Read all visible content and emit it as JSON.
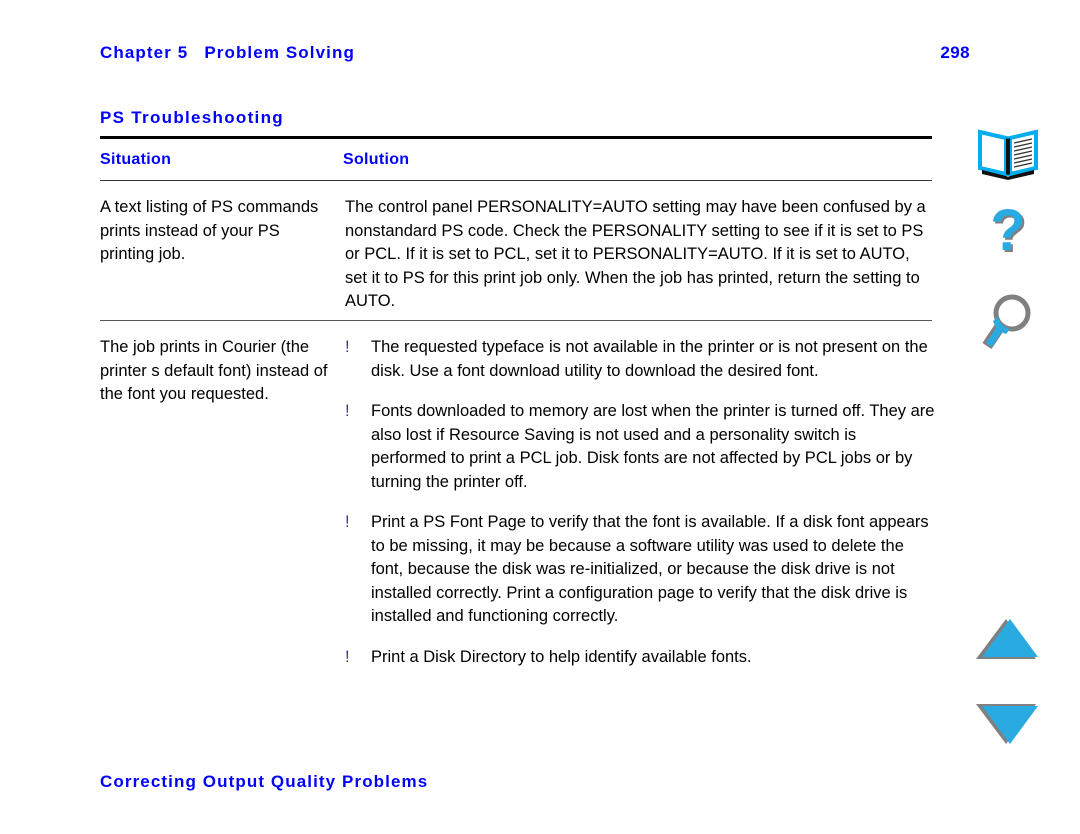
{
  "colors": {
    "heading_blue": "#0000FF",
    "bullet_blue": "#3333CC",
    "icon_cyan": "#29ABE2",
    "icon_shadow": "#808080",
    "rule_black": "#000000"
  },
  "header": {
    "chapter_label": "Chapter 5",
    "chapter_title": "Problem Solving",
    "page_number": "298"
  },
  "section": {
    "title": "PS Troubleshooting"
  },
  "table": {
    "columns": [
      "Situation",
      "Solution"
    ],
    "rows": [
      {
        "situation": "A text listing of PS commands prints instead of your PS printing job.",
        "solution_paragraph": "The control panel PERSONALITY=AUTO setting may have been confused by a nonstandard PS code. Check the PERSONALITY setting to see if it is set to PS or PCL. If it is set to PCL, set it to PERSONALITY=AUTO. If it is set to AUTO, set it to PS for this print job only. When the job has printed, return the setting to AUTO.",
        "solution_bullets": []
      },
      {
        "situation": "The job prints in Courier (the printer s default font) instead of the font you requested.",
        "solution_paragraph": "",
        "solution_bullets": [
          "The requested typeface is not available in the printer or is not present on the disk. Use a font download utility to download the desired font.",
          "Fonts downloaded to memory are lost when the printer is turned off. They are also lost if Resource Saving is not used and a personality switch is performed to print a PCL job. Disk fonts are not affected by PCL jobs or by turning the printer off.",
          "Print a PS Font Page to verify that the font is available. If a disk font appears to be missing, it may be because a software utility was used to delete the font, because the disk was re-initialized, or because the disk drive is not installed correctly. Print a configuration page to verify that the disk drive is installed and functioning correctly.",
          "Print a Disk Directory to help identify available fonts."
        ]
      }
    ],
    "bullet_glyph": "!"
  },
  "footer": {
    "next_section_title": "Correcting Output Quality Problems"
  },
  "sidebar": {
    "icons": [
      {
        "name": "book-icon",
        "label": "Contents"
      },
      {
        "name": "question-mark-icon",
        "label": "Help"
      },
      {
        "name": "magnifier-icon",
        "label": "Search"
      },
      {
        "name": "triangle-up-icon",
        "label": "Previous Page"
      },
      {
        "name": "triangle-down-icon",
        "label": "Next Page"
      }
    ]
  }
}
